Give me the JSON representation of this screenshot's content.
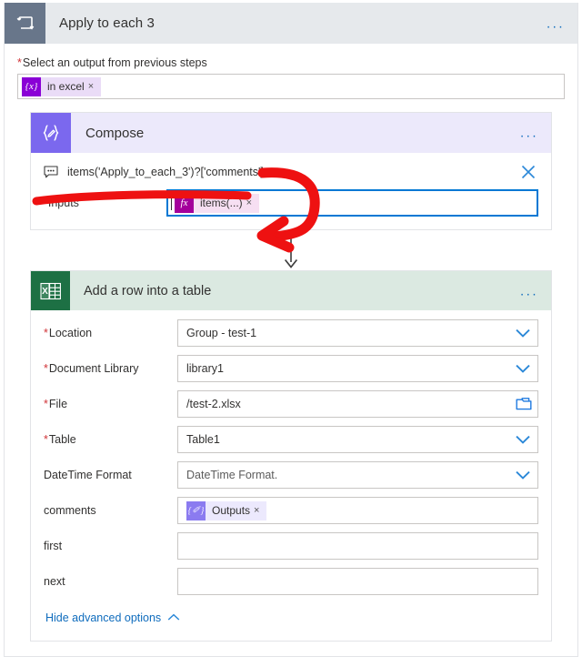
{
  "loop": {
    "icon": "loop-repeat-icon",
    "title": "Apply to each 3",
    "more_label": "...",
    "field": {
      "label": "Select an output from previous steps",
      "required": true,
      "token": {
        "badge": "{x}",
        "text": "in excel",
        "remove": "×"
      }
    }
  },
  "compose": {
    "icon": "compose-braces-pencil-icon",
    "title": "Compose",
    "more_label": "...",
    "expression": {
      "icon": "comment-bubble-icon",
      "text": "items('Apply_to_each_3')?['comments']",
      "close": "✕"
    },
    "inputs": {
      "label": "Inputs",
      "required": true,
      "token": {
        "badge": "fx",
        "text": "items(...)",
        "remove": "×"
      }
    }
  },
  "connector": {
    "icon": "down-arrow-icon"
  },
  "excel": {
    "icon": "excel-table-icon",
    "title": "Add a row into a table",
    "more_label": "...",
    "fields": [
      {
        "label": "Location",
        "required": true,
        "value": "Group - test-1",
        "control": "dropdown"
      },
      {
        "label": "Document Library",
        "required": true,
        "value": "library1",
        "control": "dropdown"
      },
      {
        "label": "File",
        "required": true,
        "value": "/test-2.xlsx",
        "control": "folder"
      },
      {
        "label": "Table",
        "required": true,
        "value": "Table1",
        "control": "dropdown"
      },
      {
        "label": "DateTime Format",
        "required": false,
        "value": "DateTime Format.",
        "control": "dropdown"
      },
      {
        "label": "comments",
        "required": false,
        "value": "",
        "control": "token",
        "token": {
          "badge": "{✐}",
          "text": "Outputs",
          "remove": "×"
        }
      },
      {
        "label": "first",
        "required": false,
        "value": "",
        "control": "text"
      },
      {
        "label": "next",
        "required": false,
        "value": "",
        "control": "text"
      }
    ],
    "advanced": {
      "label": "Hide advanced options",
      "chevron": "chevron-up-icon"
    }
  },
  "colors": {
    "loop_header_bg": "#e6e9ec",
    "loop_icon_bg": "#68768a",
    "compose_header_bg": "#ece9fb",
    "compose_icon_bg": "#7b68ee",
    "excel_header_bg": "#dbe9e1",
    "excel_icon_bg": "#1d7044",
    "accent_blue": "#0078d4",
    "link_blue": "#0f6cbd",
    "required_red": "#d13438",
    "annotation_red": "#ee1111",
    "token_purple": "#8a00d6",
    "token_magenta": "#a4009b",
    "token_periwinkle": "#8b7bf0"
  },
  "annotations": {
    "underline": "red-underline-stroke",
    "arrow": "red-curved-arrow"
  }
}
